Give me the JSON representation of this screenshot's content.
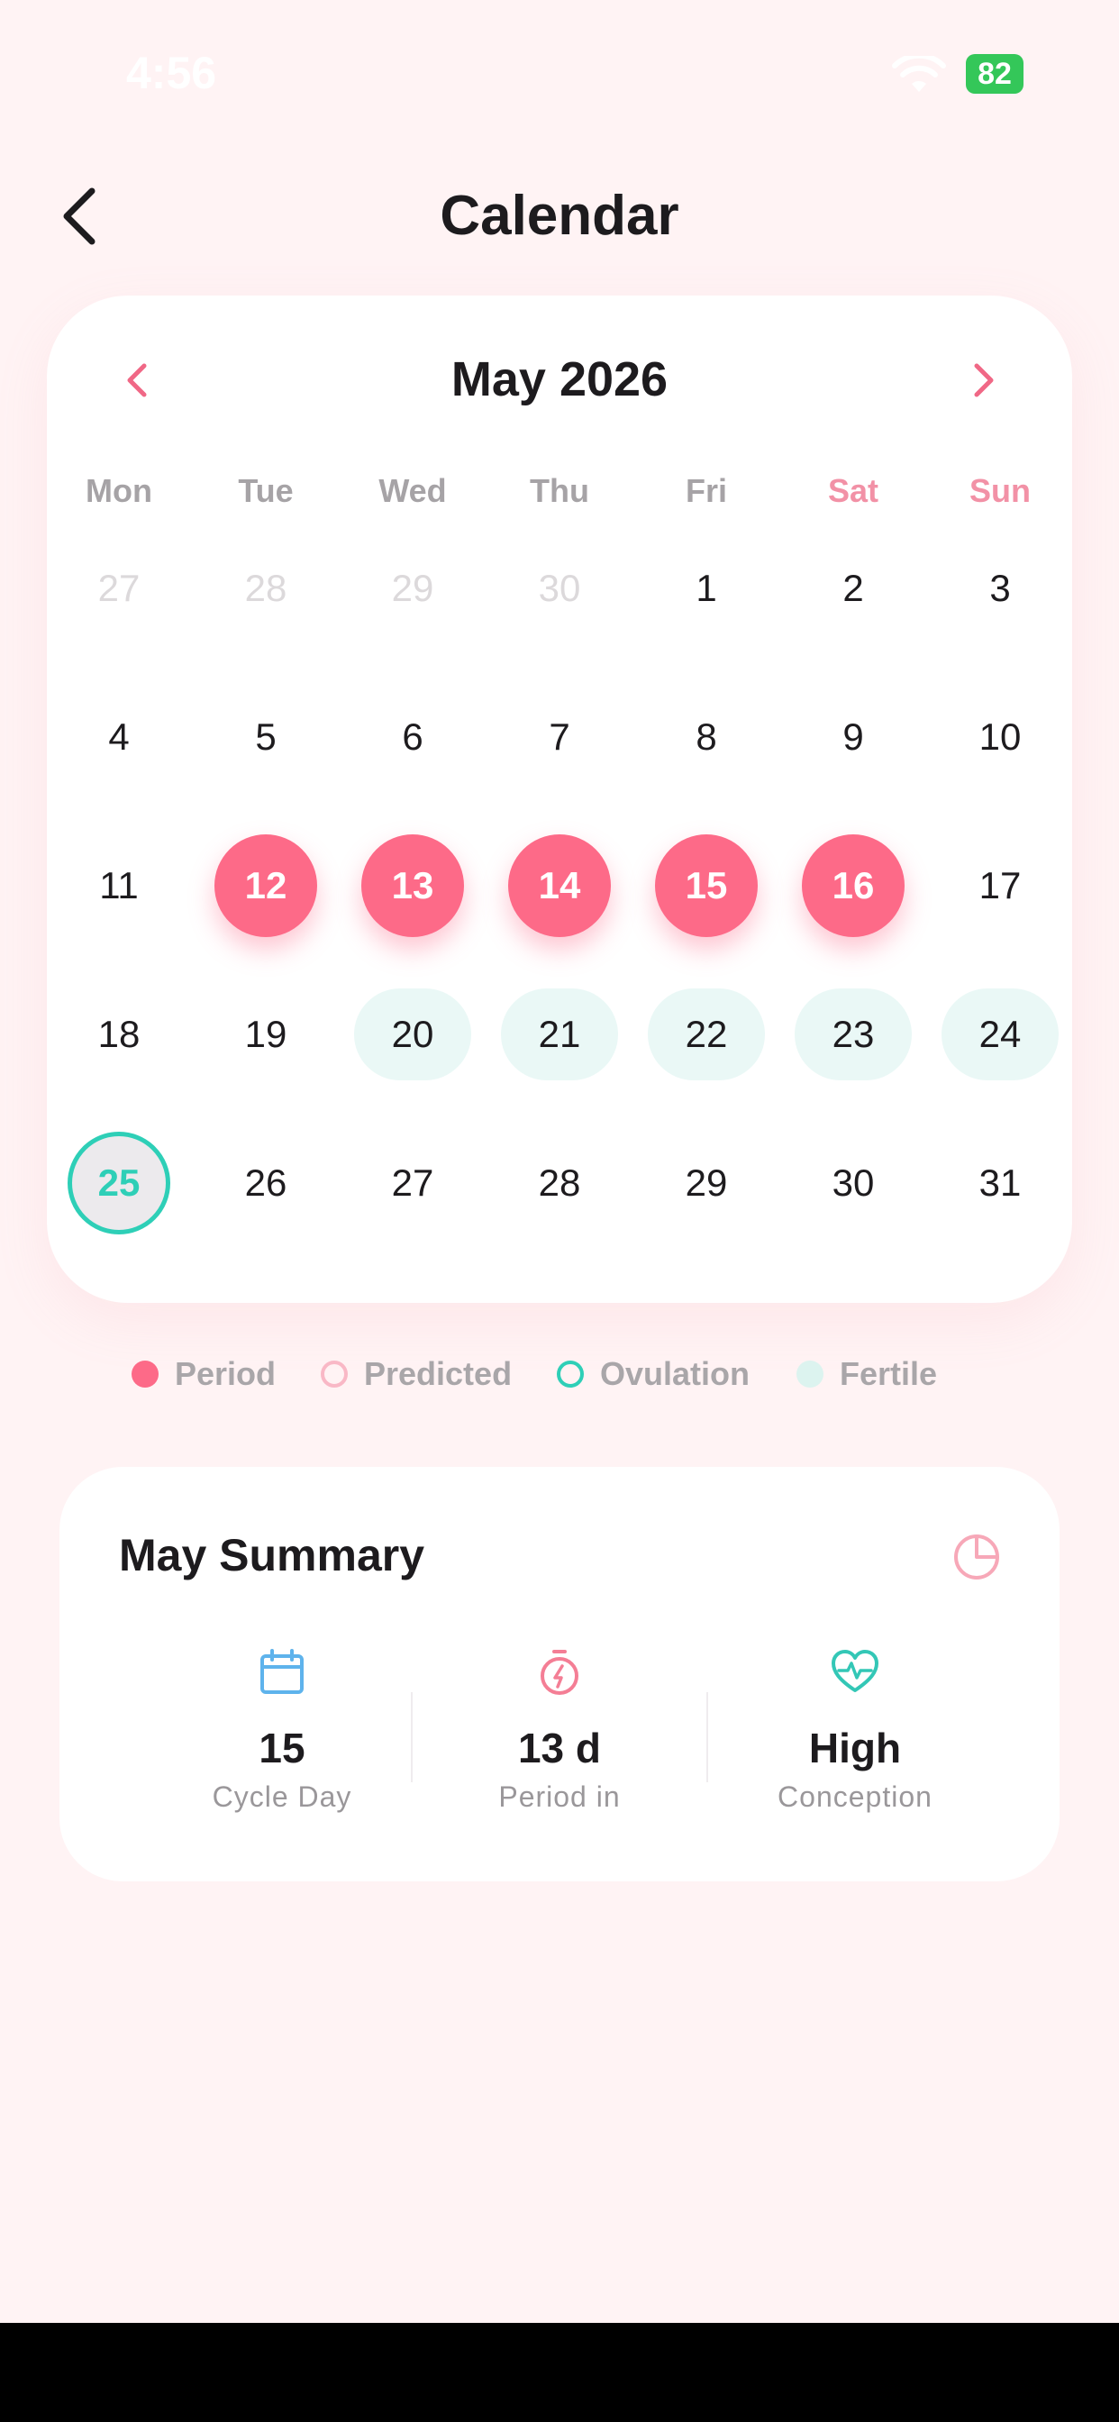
{
  "status_bar": {
    "time": "4:56",
    "battery": "82"
  },
  "header": {
    "title": "Calendar"
  },
  "calendar": {
    "month_title": "May 2026",
    "weekdays": [
      "Mon",
      "Tue",
      "Wed",
      "Thu",
      "Fri",
      "Sat",
      "Sun"
    ],
    "weeks": [
      [
        "27",
        "28",
        "29",
        "30",
        "1",
        "2",
        "3"
      ],
      [
        "4",
        "5",
        "6",
        "7",
        "8",
        "9",
        "10"
      ],
      [
        "11",
        "12",
        "13",
        "14",
        "15",
        "16",
        "17"
      ],
      [
        "18",
        "19",
        "20",
        "21",
        "22",
        "23",
        "24"
      ],
      [
        "25",
        "26",
        "27",
        "28",
        "29",
        "30",
        "31"
      ]
    ],
    "period_days": [
      "12",
      "13",
      "14",
      "15",
      "16"
    ],
    "fertile_days": [
      "20",
      "21",
      "22",
      "23",
      "24"
    ],
    "ovulation_day": "25"
  },
  "legend": [
    {
      "label": "Period",
      "color": "#fd6a88"
    },
    {
      "label": "Predicted",
      "color": "#f9b8c6"
    },
    {
      "label": "Ovulation",
      "color": "#2ecfb7"
    },
    {
      "label": "Fertile",
      "color": "#dcf3ef"
    }
  ],
  "summary": {
    "title": "May Summary",
    "stats": [
      {
        "icon": "calendar-icon",
        "value": "15",
        "label": "Cycle Day"
      },
      {
        "icon": "timer-icon",
        "value": "13 d",
        "label": "Period in"
      },
      {
        "icon": "heart-pulse-icon",
        "value": "High",
        "label": "Conception"
      }
    ]
  },
  "colors": {
    "accent_pink": "#fd6a88",
    "teal": "#2ecfb7",
    "background": "#fff3f4"
  }
}
